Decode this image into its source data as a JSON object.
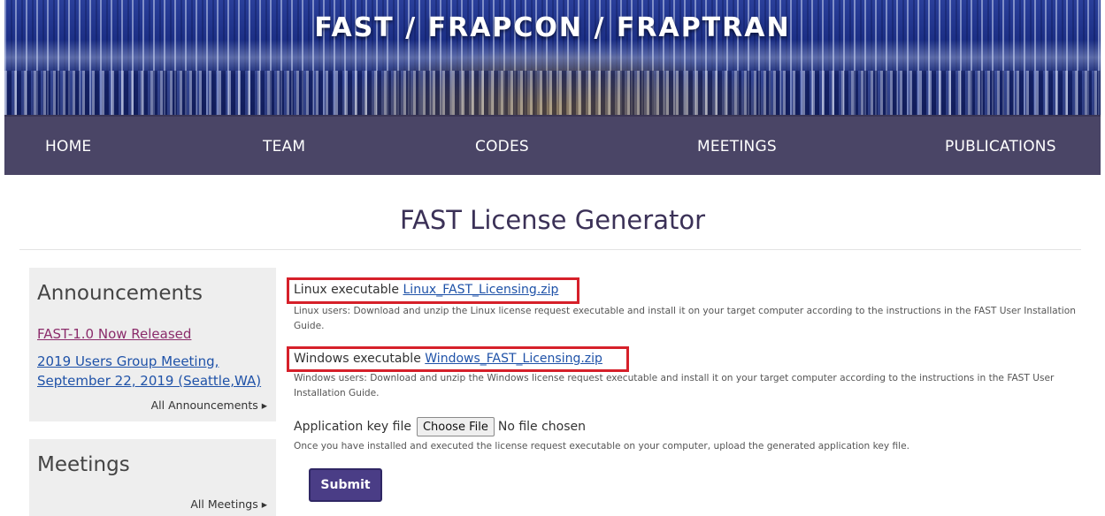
{
  "banner": {
    "title": "FAST / FRAPCON / FRAPTRAN"
  },
  "nav": {
    "items": [
      {
        "label": "HOME"
      },
      {
        "label": "TEAM"
      },
      {
        "label": "CODES"
      },
      {
        "label": "MEETINGS"
      },
      {
        "label": "PUBLICATIONS"
      }
    ]
  },
  "page": {
    "title": "FAST License Generator"
  },
  "sidebar": {
    "announcements": {
      "heading": "Announcements",
      "items": [
        {
          "label": "FAST-1.0 Now Released"
        },
        {
          "label": "2019 Users Group Meeting, September 22, 2019 (Seattle,WA)"
        }
      ],
      "all_link": "All Announcements ▸"
    },
    "meetings": {
      "heading": "Meetings",
      "all_link": "All Meetings ▸"
    }
  },
  "main": {
    "linux": {
      "label": "Linux executable",
      "link": "Linux_FAST_Licensing.zip",
      "description": "Linux users: Download and unzip the Linux license request executable and install it on your target computer according to the instructions in the FAST User Installation Guide."
    },
    "windows": {
      "label": "Windows executable",
      "link": "Windows_FAST_Licensing.zip",
      "description": "Windows users: Download and unzip the Windows license request executable and install it on your target computer according to the instructions in the FAST User Installation Guide."
    },
    "app_key": {
      "label": "Application key file",
      "button": "Choose File",
      "status": "No file chosen",
      "description": "Once you have installed and executed the license request executable on your computer, upload the generated application key file."
    },
    "submit_label": "Submit"
  },
  "colors": {
    "nav_bg": "#4a4566",
    "title": "#3b3157",
    "highlight_box": "#d6202a",
    "submit_bg": "#4a3d86",
    "link": "#1f52a8",
    "visited_link": "#8b2c6b"
  }
}
